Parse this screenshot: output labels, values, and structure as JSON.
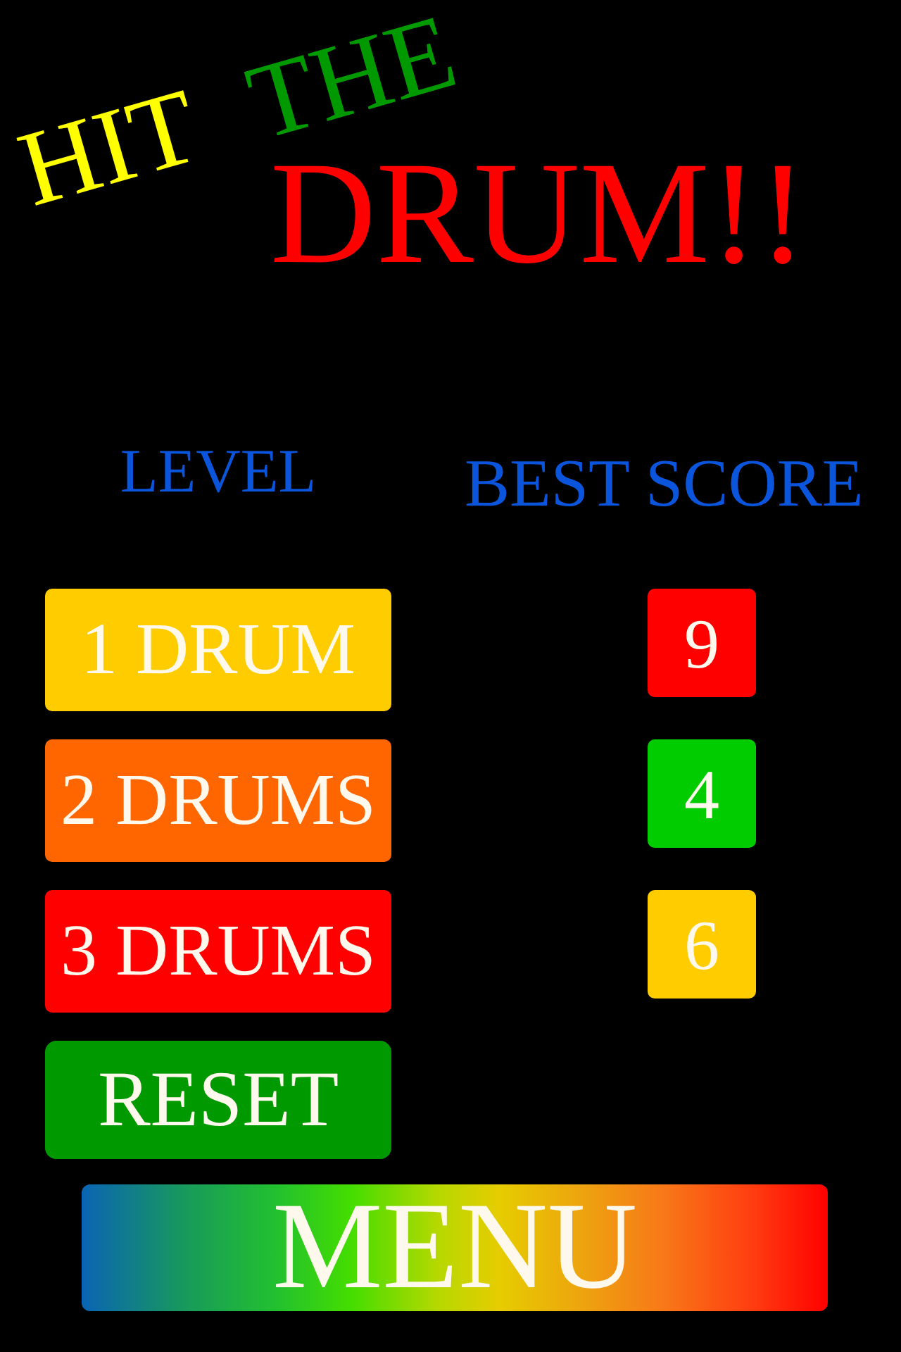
{
  "title": {
    "words": [
      {
        "text": "HIT",
        "kind": "tilted",
        "color": "#ffff00"
      },
      {
        "text": "THE",
        "kind": "tilted",
        "color": "#009900"
      },
      {
        "text": "DRUM!!",
        "kind": "large",
        "color": "#ff0000"
      }
    ]
  },
  "headings": {
    "level": "LEVEL",
    "best_score": "BEST SCORE"
  },
  "levels": [
    {
      "label": "1 DRUM",
      "color": "#ffcc00"
    },
    {
      "label": "2 DRUMS",
      "color": "#ff6600"
    },
    {
      "label": "3 DRUMS",
      "color": "#ff0000"
    }
  ],
  "best_scores": [
    {
      "value": "9",
      "color": "#ff0000"
    },
    {
      "value": "4",
      "color": "#00cc00"
    },
    {
      "value": "6",
      "color": "#ffcc00"
    }
  ],
  "reset_button": {
    "label": "RESET"
  },
  "menu_button": {
    "label": "MENU"
  }
}
